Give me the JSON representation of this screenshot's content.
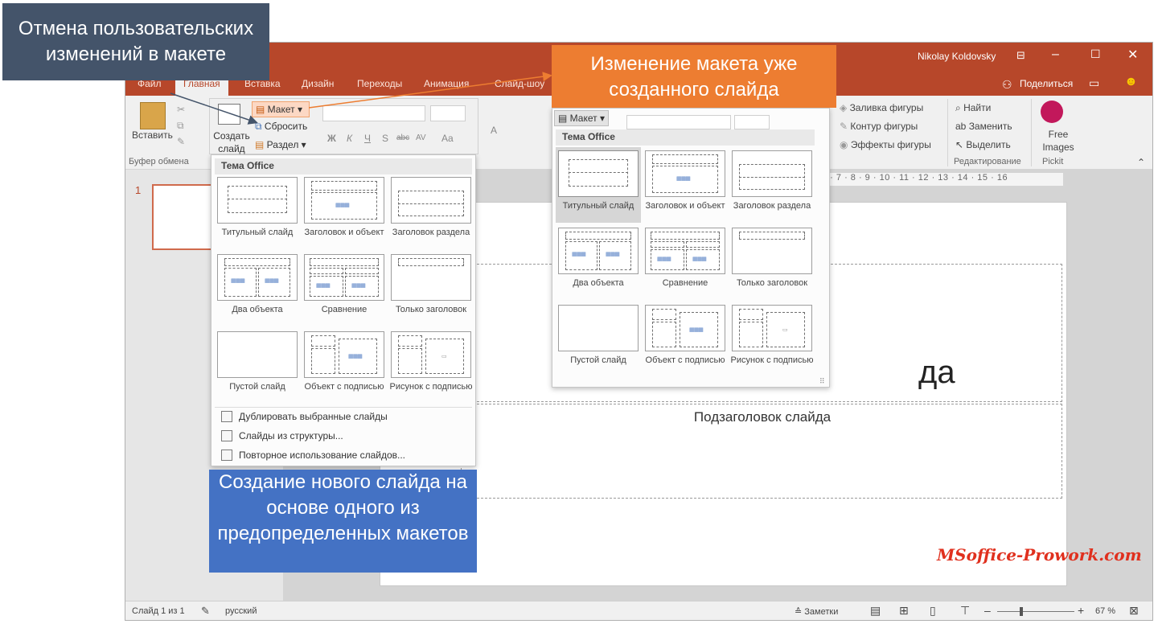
{
  "window": {
    "user": "Nikolay Koldovsky",
    "tabs": [
      "Файл",
      "Главная",
      "Вставка",
      "Дизайн",
      "Переходы",
      "Анимация",
      "Слайд-шоу"
    ],
    "share": "Поделиться"
  },
  "ribbon": {
    "paste": "Вставить",
    "clipboard_group": "Буфер обмена",
    "new_slide": "Создать слайд",
    "layout": "Макет",
    "reset": "Сбросить",
    "section": "Раздел",
    "font_buttons": [
      "Ж",
      "К",
      "Ч",
      "S",
      "abc",
      "AV",
      "Aa"
    ],
    "shape_fill": "Заливка фигуры",
    "shape_outline": "Контур фигуры",
    "shape_effects": "Эффекты фигуры",
    "find": "Найти",
    "replace": "Заменить",
    "select": "Выделить",
    "editing_group": "Редактирование",
    "free_images": "Free Images",
    "pickit": "Pickit",
    "ruler_right": "6 · 7 · 8 · 9 · 10 · 11 · 12 · 13 · 14 · 15 · 16"
  },
  "slide": {
    "number": "1",
    "title_fragment": "да",
    "subtitle": "Подзаголовок слайда"
  },
  "new_slide_gallery": {
    "header": "Тема Office",
    "layouts": [
      {
        "name": "Титульный слайд"
      },
      {
        "name": "Заголовок и объект"
      },
      {
        "name": "Заголовок раздела"
      },
      {
        "name": "Два объекта"
      },
      {
        "name": "Сравнение"
      },
      {
        "name": "Только заголовок"
      },
      {
        "name": "Пустой слайд"
      },
      {
        "name": "Объект с подписью"
      },
      {
        "name": "Рисунок с подписью"
      }
    ],
    "menu": [
      {
        "label": "Дублировать выбранные слайды"
      },
      {
        "label": "Слайды из структуры..."
      },
      {
        "label": "Повторное использование слайдов..."
      }
    ]
  },
  "layout_gallery": {
    "button": "Макет",
    "header": "Тема Office",
    "layouts": [
      {
        "name": "Титульный слайд"
      },
      {
        "name": "Заголовок и объект"
      },
      {
        "name": "Заголовок раздела"
      },
      {
        "name": "Два объекта"
      },
      {
        "name": "Сравнение"
      },
      {
        "name": "Только заголовок"
      },
      {
        "name": "Пустой слайд"
      },
      {
        "name": "Объект с подписью"
      },
      {
        "name": "Рисунок с подписью"
      }
    ]
  },
  "callouts": {
    "reset": "Отмена пользовательских изменений в макете",
    "change": "Изменение макета уже созданного слайда",
    "new": "Создание нового слайда на основе одного из предопределенных макетов"
  },
  "statusbar": {
    "slide_info": "Слайд 1 из 1",
    "language": "русский",
    "notes": "Заметки",
    "zoom": "67 %"
  },
  "watermark": "MSoffice-Prowork.com",
  "colors": {
    "accent": "#b7472a",
    "callout_reset": "#44546a",
    "callout_change": "#ed7d31",
    "callout_new": "#4472c4"
  }
}
